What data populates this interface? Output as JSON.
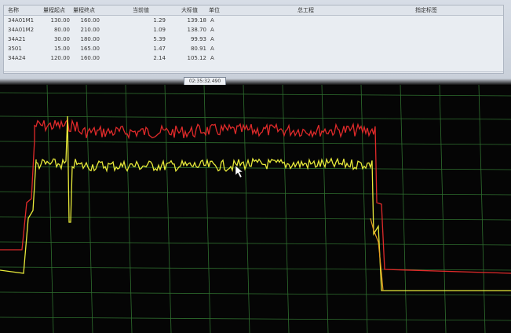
{
  "table": {
    "headers": {
      "name": "名称",
      "range_start": "量程起点",
      "range_end": "量程终点",
      "current": "当前值",
      "max": "大标值",
      "unit": "单位",
      "process": "总工程",
      "tag": "指定标签"
    },
    "rows": [
      {
        "name": "34A01M1",
        "range_start": "130.00",
        "range_end": "160.00",
        "current": "1.29",
        "max": "139.18",
        "unit": "A"
      },
      {
        "name": "34A01M2",
        "range_start": "80.00",
        "range_end": "210.00",
        "current": "1.09",
        "max": "138.70",
        "unit": "A"
      },
      {
        "name": "34A21",
        "range_start": "30.00",
        "range_end": "180.00",
        "current": "5.39",
        "max": "99.93",
        "unit": "A"
      },
      {
        "name": "3501",
        "range_start": "15.00",
        "range_end": "165.00",
        "current": "1.47",
        "max": "80.91",
        "unit": "A"
      },
      {
        "name": "34A24",
        "range_start": "120.00",
        "range_end": "160.00",
        "current": "2.14",
        "max": "105.12",
        "unit": "A"
      }
    ]
  },
  "status": {
    "time": "02:35:32.490"
  },
  "colors": {
    "grid": "#2f6f2f",
    "red_trace": "#e02a2a",
    "yellow_trace": "#e8ea3a",
    "orange_trace": "#e89a20",
    "background": "#050505"
  }
}
